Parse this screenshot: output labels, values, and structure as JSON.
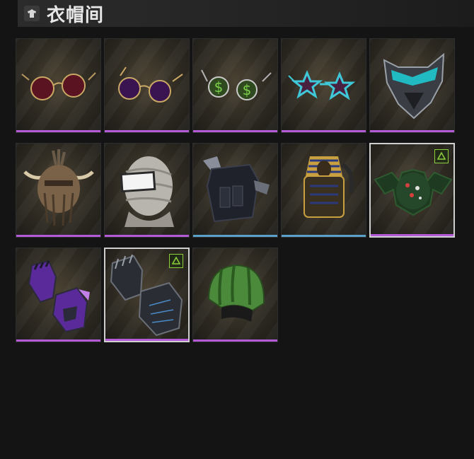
{
  "header": {
    "title": "衣帽间",
    "icon": "wardrobe-icon"
  },
  "colors": {
    "purple": "#b35ad6",
    "blue": "#5aa0c8",
    "badge": "#8ccf3a"
  },
  "items": [
    {
      "name": "round-red-sunglasses",
      "rarity": "purple",
      "badge": false,
      "selected": false
    },
    {
      "name": "round-purple-sunglasses",
      "rarity": "purple",
      "badge": false,
      "selected": false
    },
    {
      "name": "dollar-sign-glasses",
      "rarity": "purple",
      "badge": false,
      "selected": false
    },
    {
      "name": "star-shaped-glasses",
      "rarity": "purple",
      "badge": false,
      "selected": false
    },
    {
      "name": "cyber-face-mask",
      "rarity": "purple",
      "badge": false,
      "selected": false
    },
    {
      "name": "horned-tribal-helmet",
      "rarity": "purple",
      "badge": false,
      "selected": false
    },
    {
      "name": "bandage-head-wrap",
      "rarity": "purple",
      "badge": false,
      "selected": false
    },
    {
      "name": "tactical-vest",
      "rarity": "blue",
      "badge": false,
      "selected": false
    },
    {
      "name": "pharaoh-backpack",
      "rarity": "blue",
      "badge": false,
      "selected": false
    },
    {
      "name": "bat-backpack",
      "rarity": "purple",
      "badge": true,
      "selected": true
    },
    {
      "name": "purple-gloves",
      "rarity": "purple",
      "badge": false,
      "selected": false
    },
    {
      "name": "dark-claw-gloves",
      "rarity": "purple",
      "badge": true,
      "selected": true
    },
    {
      "name": "watermelon-helmet",
      "rarity": "purple",
      "badge": false,
      "selected": false
    }
  ]
}
